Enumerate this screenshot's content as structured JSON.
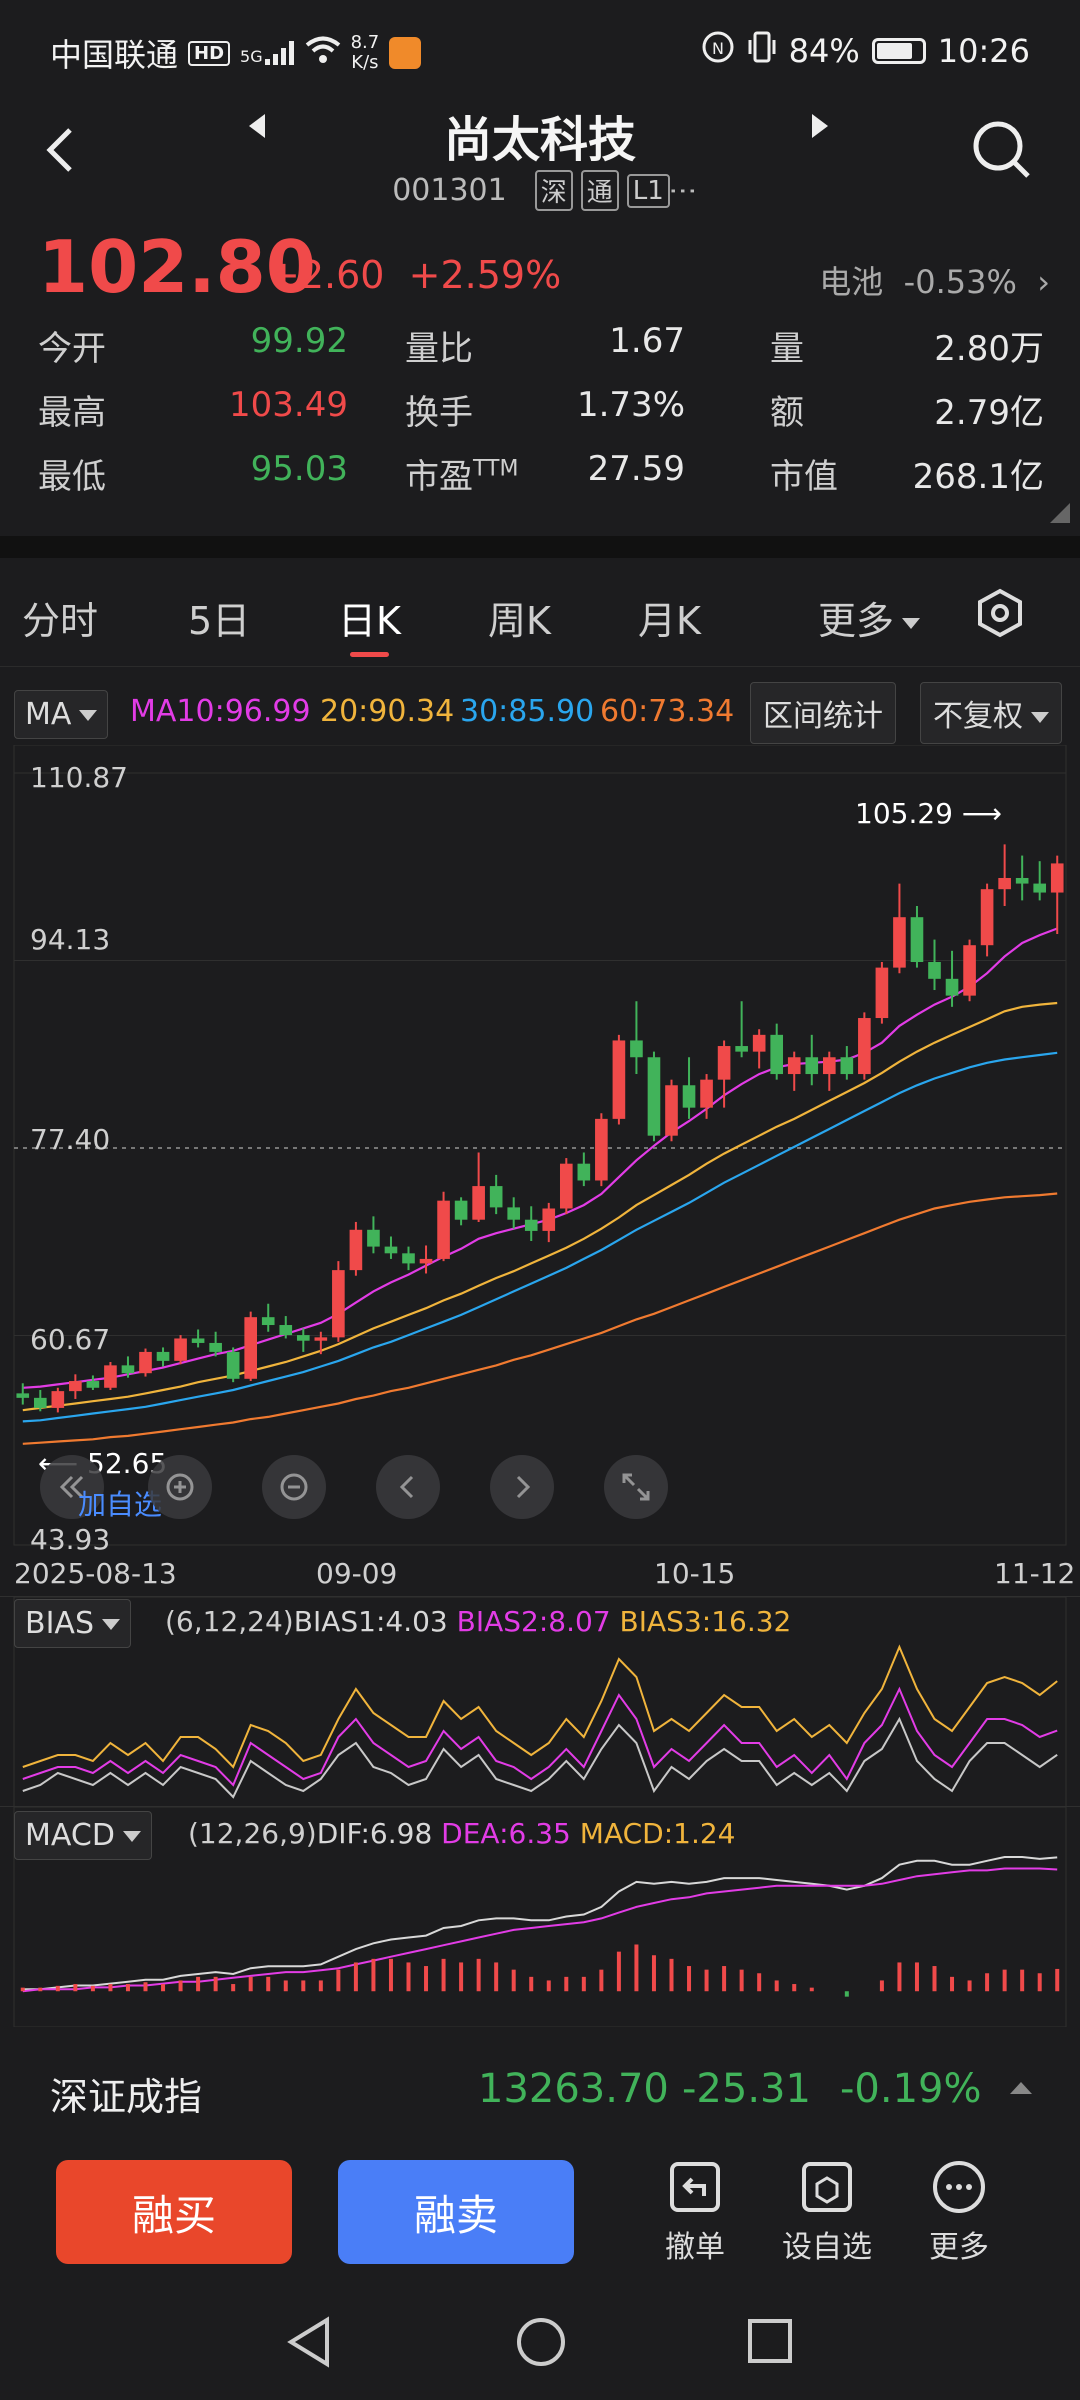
{
  "status": {
    "carrier": "中国联通",
    "hd": "HD",
    "net": "5G",
    "speed_value": "8.7",
    "speed_unit": "K/s",
    "battery_pct": "84%",
    "time": "10:26",
    "battery_level": 0.84
  },
  "header": {
    "title": "尚太科技",
    "code": "001301",
    "tags": [
      "深",
      "通",
      "L1"
    ]
  },
  "quote": {
    "price": "102.80",
    "change": "+2.60",
    "change_pct": "+2.59%",
    "related_label": "电池",
    "related_value": "-0.53%",
    "stats": {
      "open_label": "今开",
      "open": "99.92",
      "high_label": "最高",
      "high": "103.49",
      "low_label": "最低",
      "low": "95.03",
      "vr_label": "量比",
      "vr": "1.67",
      "turnover_label": "换手",
      "turnover": "1.73%",
      "pe_label": "市盈",
      "pe_sup": "TTM",
      "pe": "27.59",
      "vol_label": "量",
      "vol": "2.80万",
      "amount_label": "额",
      "amount": "2.79亿",
      "mcap_label": "市值",
      "mcap": "268.1亿"
    }
  },
  "tabs": [
    "分时",
    "5日",
    "日K",
    "周K",
    "月K",
    "更多"
  ],
  "active_tab": "日K",
  "ma_bar": {
    "select": "MA",
    "ma10": "MA10:96.99",
    "ma20": "20:90.34",
    "ma30": "30:85.90",
    "ma60": "60:73.34",
    "range_stat": "区间统计",
    "adjust": "不复权"
  },
  "colors": {
    "up": "#f04a4a",
    "down": "#41b35a",
    "ma10": "#e23ce6",
    "ma20": "#f0b43c",
    "ma30": "#2aa6ee",
    "ma60": "#f07a30"
  },
  "chart_data": [
    {
      "type": "candlestick",
      "y_ticks": [
        "110.87",
        "94.13",
        "77.40",
        "60.67",
        "43.93"
      ],
      "ylim": [
        43.93,
        110.87
      ],
      "x_ticks": [
        "2025-08-13",
        "09-09",
        "10-15",
        "11-12"
      ],
      "annotations": {
        "high": "105.29",
        "low": "52.65",
        "add_watch": "加自选"
      },
      "candles": [
        [
          55.5,
          56.4,
          54.5,
          55.1
        ],
        [
          55.1,
          55.8,
          53.9,
          54.2
        ],
        [
          54.2,
          56.0,
          53.8,
          55.7
        ],
        [
          55.7,
          57.2,
          55.0,
          56.6
        ],
        [
          56.6,
          57.1,
          55.8,
          56.0
        ],
        [
          56.0,
          58.3,
          55.8,
          58.0
        ],
        [
          58.0,
          58.8,
          56.9,
          57.3
        ],
        [
          57.3,
          59.5,
          57.0,
          59.2
        ],
        [
          59.2,
          59.6,
          57.9,
          58.4
        ],
        [
          58.4,
          60.7,
          58.1,
          60.4
        ],
        [
          60.4,
          61.2,
          59.6,
          60.0
        ],
        [
          60.0,
          61.0,
          58.8,
          59.2
        ],
        [
          59.2,
          59.6,
          56.5,
          56.8
        ],
        [
          56.8,
          62.8,
          56.6,
          62.3
        ],
        [
          62.3,
          63.5,
          61.0,
          61.6
        ],
        [
          61.6,
          62.4,
          60.4,
          60.7
        ],
        [
          60.7,
          61.3,
          59.2,
          60.2
        ],
        [
          60.2,
          61.0,
          59.0,
          60.5
        ],
        [
          60.5,
          67.3,
          60.1,
          66.5
        ],
        [
          66.5,
          70.8,
          66.0,
          70.1
        ],
        [
          70.1,
          71.3,
          68.0,
          68.6
        ],
        [
          68.6,
          69.5,
          67.5,
          68.0
        ],
        [
          68.0,
          68.6,
          66.5,
          67.1
        ],
        [
          67.1,
          68.7,
          66.2,
          67.5
        ],
        [
          67.5,
          73.5,
          67.3,
          72.7
        ],
        [
          72.7,
          73.0,
          70.5,
          71.0
        ],
        [
          71.0,
          77.0,
          70.8,
          74.0
        ],
        [
          74.0,
          75.0,
          71.5,
          72.1
        ],
        [
          72.1,
          73.0,
          70.2,
          71.0
        ],
        [
          71.0,
          72.2,
          69.1,
          70.0
        ],
        [
          70.0,
          72.5,
          69.0,
          72.0
        ],
        [
          72.0,
          76.5,
          71.5,
          76.0
        ],
        [
          76.0,
          77.0,
          74.0,
          74.5
        ],
        [
          74.5,
          80.5,
          74.0,
          80.0
        ],
        [
          80.0,
          87.5,
          79.5,
          87.0
        ],
        [
          87.0,
          90.5,
          84.0,
          85.5
        ],
        [
          85.5,
          86.0,
          78.0,
          78.5
        ],
        [
          78.5,
          83.5,
          78.0,
          83.0
        ],
        [
          83.0,
          85.5,
          80.0,
          81.0
        ],
        [
          81.0,
          84.0,
          80.0,
          83.5
        ],
        [
          83.5,
          87.0,
          81.0,
          86.5
        ],
        [
          86.5,
          90.5,
          85.5,
          86.0
        ],
        [
          86.0,
          88.0,
          84.5,
          87.5
        ],
        [
          87.5,
          88.5,
          83.5,
          84.0
        ],
        [
          84.0,
          86.0,
          82.5,
          85.5
        ],
        [
          85.5,
          87.5,
          83.0,
          84.0
        ],
        [
          84.0,
          86.0,
          82.5,
          85.5
        ],
        [
          85.5,
          86.5,
          83.5,
          84.0
        ],
        [
          84.0,
          89.5,
          83.5,
          89.0
        ],
        [
          89.0,
          94.0,
          88.5,
          93.5
        ],
        [
          93.5,
          101.0,
          93.0,
          98.0
        ],
        [
          98.0,
          99.0,
          93.5,
          94.0
        ],
        [
          94.0,
          96.0,
          91.5,
          92.5
        ],
        [
          92.5,
          95.0,
          90.0,
          91.0
        ],
        [
          91.0,
          96.0,
          90.5,
          95.5
        ],
        [
          95.5,
          101.0,
          94.5,
          100.5
        ],
        [
          100.5,
          104.5,
          99.0,
          101.5
        ],
        [
          101.5,
          103.5,
          99.5,
          101.0
        ],
        [
          101.0,
          103.0,
          99.5,
          100.2
        ],
        [
          100.2,
          103.5,
          96.5,
          102.8
        ]
      ],
      "ma10": [
        56.0,
        56.1,
        56.3,
        56.5,
        56.7,
        56.9,
        57.2,
        57.5,
        57.8,
        58.2,
        58.6,
        59.0,
        59.3,
        59.8,
        60.3,
        60.8,
        61.3,
        61.8,
        62.6,
        63.6,
        64.6,
        65.4,
        66.1,
        66.9,
        67.7,
        68.4,
        69.3,
        69.8,
        70.2,
        70.6,
        71.0,
        71.6,
        72.3,
        73.3,
        74.8,
        76.3,
        77.6,
        78.8,
        79.8,
        80.9,
        82.1,
        83.1,
        84.0,
        84.6,
        84.9,
        85.0,
        85.1,
        85.3,
        85.9,
        86.8,
        88.3,
        89.3,
        90.2,
        90.9,
        91.8,
        93.0,
        94.5,
        95.7,
        96.4,
        96.99
      ],
      "ma20": [
        54.0,
        54.2,
        54.4,
        54.6,
        54.8,
        55.0,
        55.2,
        55.5,
        55.8,
        56.1,
        56.5,
        56.8,
        57.1,
        57.5,
        57.9,
        58.3,
        58.8,
        59.3,
        59.9,
        60.6,
        61.3,
        61.9,
        62.5,
        63.1,
        63.8,
        64.4,
        65.1,
        65.8,
        66.4,
        67.1,
        67.8,
        68.5,
        69.3,
        70.2,
        71.2,
        72.3,
        73.2,
        74.1,
        75.0,
        76.0,
        76.9,
        77.7,
        78.5,
        79.3,
        80.0,
        80.8,
        81.6,
        82.4,
        83.2,
        84.1,
        85.1,
        86.0,
        86.8,
        87.5,
        88.2,
        88.9,
        89.6,
        90.0,
        90.2,
        90.34
      ],
      "ma30": [
        53.0,
        53.1,
        53.3,
        53.5,
        53.7,
        53.9,
        54.1,
        54.3,
        54.6,
        54.9,
        55.2,
        55.5,
        55.8,
        56.2,
        56.6,
        57.0,
        57.4,
        57.9,
        58.4,
        59.0,
        59.6,
        60.1,
        60.7,
        61.3,
        61.9,
        62.5,
        63.2,
        63.9,
        64.6,
        65.3,
        66.0,
        66.7,
        67.5,
        68.3,
        69.2,
        70.1,
        70.9,
        71.7,
        72.5,
        73.4,
        74.3,
        75.1,
        75.9,
        76.7,
        77.5,
        78.3,
        79.1,
        79.9,
        80.7,
        81.5,
        82.3,
        83.0,
        83.6,
        84.1,
        84.6,
        85.0,
        85.3,
        85.5,
        85.7,
        85.9
      ],
      "ma60": [
        51.0,
        51.1,
        51.2,
        51.3,
        51.4,
        51.6,
        51.7,
        51.9,
        52.1,
        52.3,
        52.5,
        52.7,
        52.9,
        53.2,
        53.4,
        53.7,
        54.0,
        54.3,
        54.6,
        55.0,
        55.3,
        55.7,
        56.0,
        56.4,
        56.8,
        57.2,
        57.6,
        58.0,
        58.5,
        58.9,
        59.4,
        59.9,
        60.4,
        60.9,
        61.5,
        62.1,
        62.6,
        63.2,
        63.8,
        64.4,
        65.0,
        65.6,
        66.2,
        66.8,
        67.4,
        68.0,
        68.6,
        69.2,
        69.8,
        70.4,
        71.0,
        71.5,
        72.0,
        72.3,
        72.6,
        72.8,
        73.0,
        73.1,
        73.2,
        73.34
      ]
    },
    {
      "type": "line",
      "name": "BIAS",
      "select": "BIAS",
      "label_prefix": "(6,12,24)",
      "series_labels": [
        "BIAS1:4.03",
        "BIAS2:8.07",
        "BIAS3:16.32"
      ],
      "series": [
        {
          "name": "BIAS1",
          "values": [
            -2,
            -1,
            1,
            0,
            -1,
            1,
            -1,
            1,
            -1,
            2,
            1,
            0,
            -3,
            3,
            1,
            -1,
            -2,
            0,
            4,
            6,
            2,
            1,
            -1,
            0,
            5,
            2,
            4,
            0,
            -1,
            -2,
            0,
            3,
            0,
            5,
            9,
            6,
            -2,
            2,
            0,
            3,
            5,
            3,
            3,
            -1,
            1,
            -1,
            1,
            -2,
            3,
            5,
            10,
            3,
            0,
            -2,
            3,
            6,
            6,
            4,
            2,
            4.03
          ]
        },
        {
          "name": "BIAS2",
          "values": [
            0,
            1,
            2,
            2,
            1,
            3,
            1,
            3,
            1,
            4,
            3,
            2,
            -1,
            6,
            4,
            2,
            0,
            1,
            7,
            10,
            6,
            4,
            2,
            3,
            8,
            5,
            7,
            3,
            2,
            0,
            2,
            5,
            2,
            8,
            14,
            10,
            2,
            5,
            3,
            6,
            9,
            6,
            6,
            2,
            4,
            1,
            4,
            0,
            6,
            9,
            15,
            8,
            4,
            2,
            6,
            10,
            10,
            9,
            7,
            8.07
          ]
        },
        {
          "name": "BIAS3",
          "values": [
            2,
            3,
            4,
            4,
            3,
            6,
            4,
            6,
            3,
            7,
            7,
            5,
            2,
            9,
            8,
            6,
            3,
            4,
            10,
            15,
            11,
            9,
            7,
            7,
            13,
            10,
            12,
            8,
            6,
            4,
            6,
            10,
            7,
            13,
            20,
            17,
            8,
            10,
            8,
            11,
            14,
            12,
            12,
            8,
            10,
            7,
            9,
            6,
            11,
            15,
            22,
            15,
            10,
            8,
            12,
            16,
            17,
            16,
            14,
            16.32
          ]
        }
      ]
    },
    {
      "type": "bar",
      "name": "MACD",
      "select": "MACD",
      "label_prefix": "(12,26,9)",
      "series_labels": [
        "DIF:6.98",
        "DEA:6.35",
        "MACD:1.24"
      ],
      "series": [
        {
          "name": "DIF",
          "values": [
            0.1,
            0.1,
            0.2,
            0.3,
            0.3,
            0.4,
            0.5,
            0.6,
            0.6,
            0.8,
            0.9,
            1.0,
            0.9,
            1.2,
            1.3,
            1.3,
            1.3,
            1.4,
            1.8,
            2.2,
            2.5,
            2.7,
            2.8,
            2.9,
            3.3,
            3.4,
            3.7,
            3.8,
            3.8,
            3.7,
            3.7,
            3.9,
            4.0,
            4.4,
            5.2,
            5.7,
            5.6,
            5.7,
            5.6,
            5.7,
            5.9,
            5.9,
            5.9,
            5.8,
            5.7,
            5.6,
            5.5,
            5.3,
            5.5,
            5.9,
            6.6,
            6.8,
            6.8,
            6.6,
            6.6,
            6.8,
            7.0,
            7.0,
            6.9,
            6.98
          ]
        },
        {
          "name": "DEA",
          "values": [
            0.0,
            0.1,
            0.1,
            0.1,
            0.2,
            0.2,
            0.3,
            0.3,
            0.4,
            0.5,
            0.5,
            0.6,
            0.7,
            0.8,
            0.9,
            1.0,
            1.0,
            1.1,
            1.2,
            1.4,
            1.6,
            1.8,
            2.0,
            2.2,
            2.4,
            2.6,
            2.8,
            3.0,
            3.2,
            3.3,
            3.4,
            3.5,
            3.6,
            3.8,
            4.1,
            4.4,
            4.6,
            4.8,
            4.9,
            5.1,
            5.2,
            5.3,
            5.4,
            5.5,
            5.5,
            5.5,
            5.5,
            5.5,
            5.5,
            5.6,
            5.8,
            6.0,
            6.1,
            6.2,
            6.3,
            6.3,
            6.4,
            6.4,
            6.4,
            6.35
          ]
        },
        {
          "name": "MACD",
          "values": [
            0.2,
            0.2,
            0.3,
            0.4,
            0.3,
            0.4,
            0.4,
            0.5,
            0.4,
            0.6,
            0.8,
            0.8,
            0.4,
            0.8,
            0.8,
            0.6,
            0.6,
            0.6,
            1.2,
            1.6,
            1.8,
            1.8,
            1.6,
            1.4,
            1.8,
            1.6,
            1.8,
            1.6,
            1.2,
            0.8,
            0.6,
            0.8,
            0.8,
            1.2,
            2.2,
            2.6,
            2.0,
            1.8,
            1.4,
            1.2,
            1.4,
            1.2,
            1.0,
            0.6,
            0.4,
            0.2,
            0.0,
            -0.3,
            0.0,
            0.6,
            1.6,
            1.6,
            1.4,
            0.8,
            0.6,
            1.0,
            1.2,
            1.2,
            1.0,
            1.24
          ]
        }
      ]
    }
  ],
  "index_bar": {
    "name": "深证成指",
    "value": "13263.70",
    "change": "-25.31",
    "change_pct": "-0.19%"
  },
  "actions": {
    "buy": "融买",
    "sell": "融卖",
    "cancel": "撤单",
    "set_watch": "设自选",
    "more": "更多"
  }
}
